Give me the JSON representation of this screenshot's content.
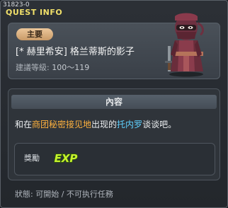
{
  "window": {
    "quest_id": "31823-0",
    "title": "QUEST INFO"
  },
  "quest": {
    "tag": "主要",
    "name": "[* 赫里希安] 格兰蒂斯的影子",
    "level_label": "建議等級:",
    "level_range": "100～119"
  },
  "content": {
    "header": "內容",
    "desc_pre": "和在",
    "desc_place": "商团秘密接见地",
    "desc_mid": "出现的",
    "desc_npc": "托内罗",
    "desc_post": "谈谈吧。",
    "highlight_place_color": "#ffb23e",
    "highlight_npc_color": "#5fd1ff"
  },
  "reward": {
    "label": "獎勵",
    "icon": "exp-icon",
    "icon_text": "EXP"
  },
  "status": {
    "text": "狀態: 可開始 / 不可执行任務"
  },
  "npc": {
    "icon": "masked-ninja-npc"
  }
}
